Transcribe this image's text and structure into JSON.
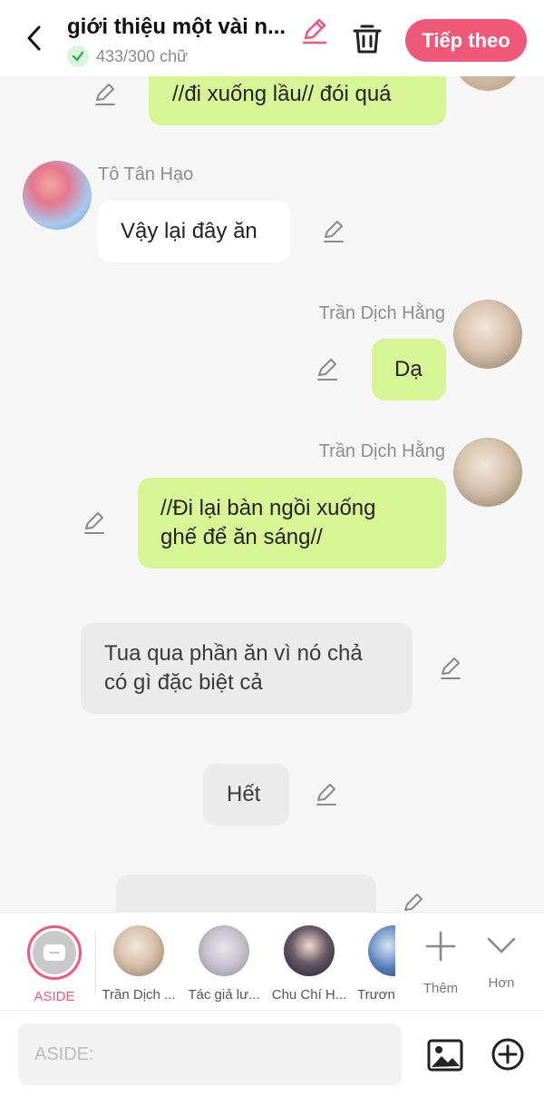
{
  "header": {
    "title": "giới thiệu một vài n...",
    "word_count": "433/300 chữ",
    "next_label": "Tiếp theo"
  },
  "chat": {
    "messages": [
      {
        "text": "//đi xuống lầu// đói quá"
      },
      {
        "speaker": "Tô Tân Hạo",
        "text": "Vậy lại đây ăn"
      },
      {
        "speaker": "Trần Dịch Hằng",
        "text": "Dạ"
      },
      {
        "speaker": "Trần Dịch Hằng",
        "text_line1": "//Đi lại bàn ngồi xuống",
        "text_line2": "ghế để ăn sáng//"
      },
      {
        "text_line1": "Tua qua phần ăn vì nó chả",
        "text_line2": "có gì đặc biệt cả"
      },
      {
        "text": "Hết"
      }
    ]
  },
  "characters": [
    {
      "label": "ASIDE"
    },
    {
      "label": "Trần Dịch ..."
    },
    {
      "label": "Tác giả lư..."
    },
    {
      "label": "Chu Chí H..."
    },
    {
      "label": "Trươn"
    }
  ],
  "tools": {
    "add_label": "Thêm",
    "more_label": "Hơn"
  },
  "input": {
    "placeholder": "ASIDE:"
  },
  "colors": {
    "accent": "#f0587a",
    "green_bubble": "#d8f596",
    "background": "#f6f6f6"
  }
}
